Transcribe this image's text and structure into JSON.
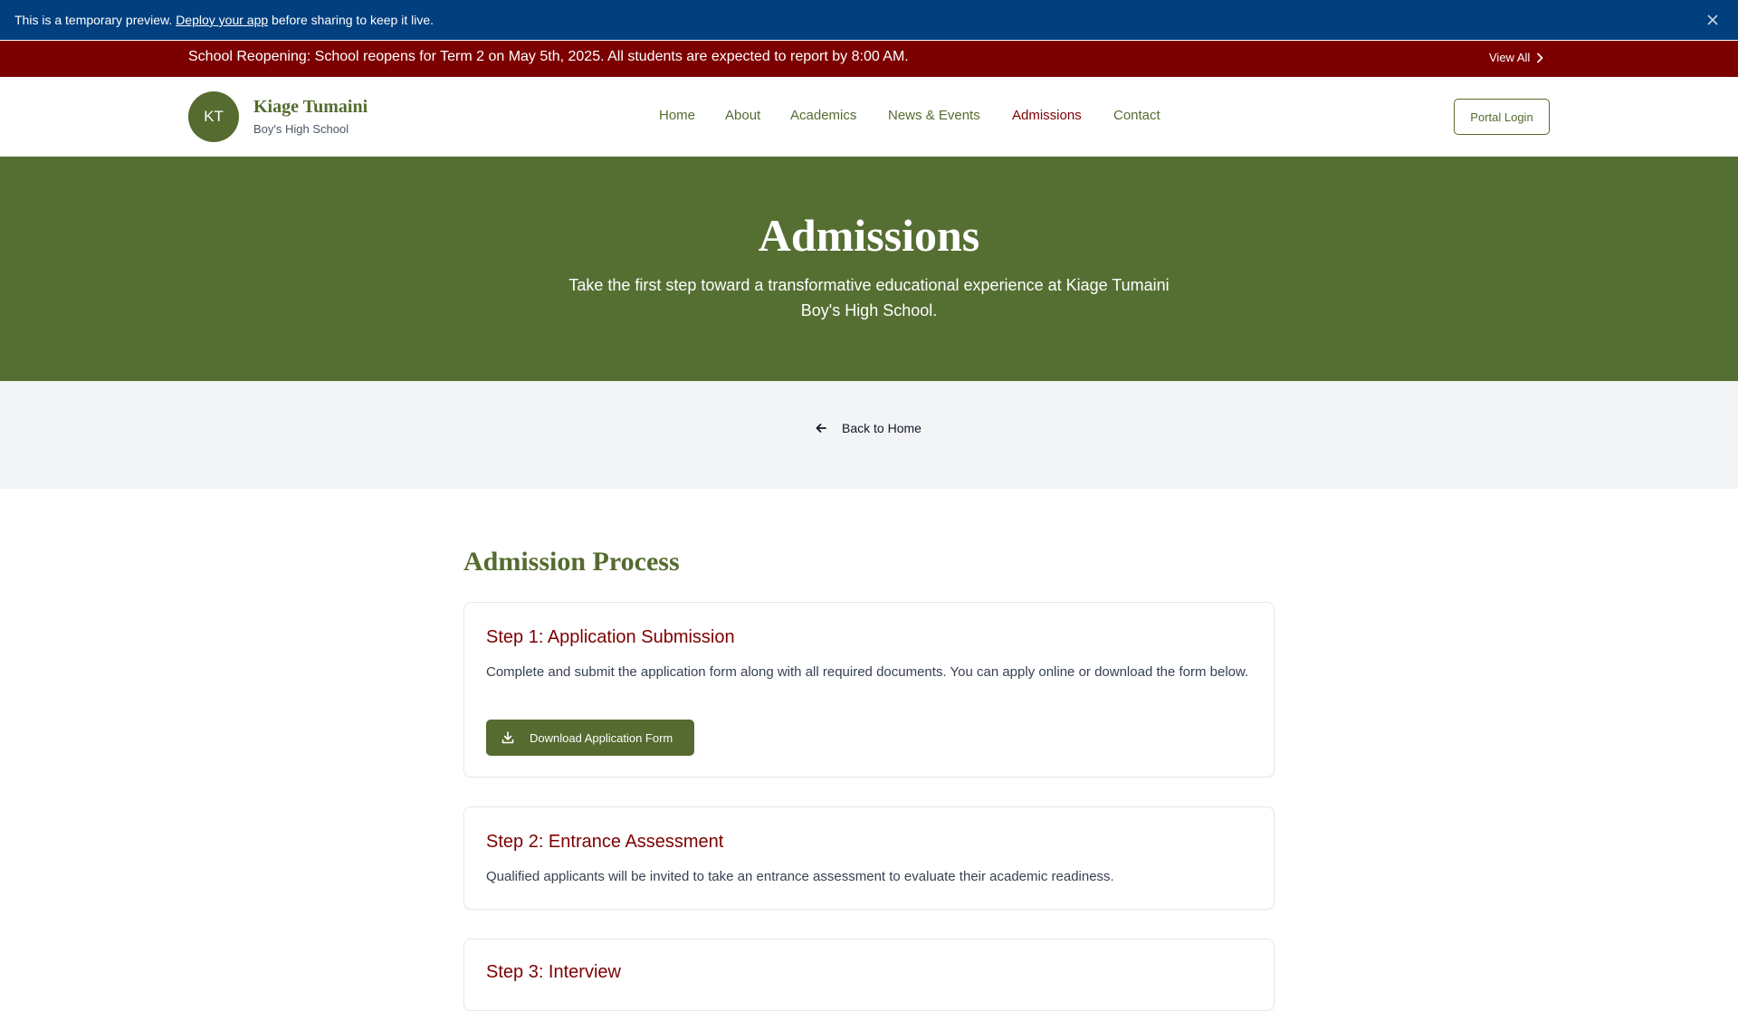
{
  "preview_bar": {
    "text_before": "This is a temporary preview.",
    "link_text": "Deploy your app",
    "text_after": "before sharing to keep it live."
  },
  "announcement": {
    "text": "School Reopening: School reopens for Term 2 on May 5th, 2025. All students are expected to report by 8:00 AM.",
    "view_all": "View All"
  },
  "header": {
    "logo_initials": "KT",
    "school_name": "Kiage Tumaini",
    "school_sub": "Boy's High School",
    "nav": [
      {
        "label": "Home",
        "active": false
      },
      {
        "label": "About",
        "active": false
      },
      {
        "label": "Academics",
        "active": false
      },
      {
        "label": "News & Events",
        "active": false
      },
      {
        "label": "Admissions",
        "active": true
      },
      {
        "label": "Contact",
        "active": false
      }
    ],
    "portal_login": "Portal Login"
  },
  "hero": {
    "title": "Admissions",
    "subtitle": "Take the first step toward a transformative educational experience at Kiage Tumaini Boy's High School."
  },
  "back_link": "Back to Home",
  "main": {
    "section_title": "Admission Process",
    "steps": [
      {
        "title": "Step 1: Application Submission",
        "text": "Complete and submit the application form along with all required documents. You can apply online or download the form below.",
        "button": "Download Application Form"
      },
      {
        "title": "Step 2: Entrance Assessment",
        "text": "Qualified applicants will be invited to take an entrance assessment to evaluate their academic readiness."
      },
      {
        "title": "Step 3: Interview"
      }
    ]
  },
  "colors": {
    "preview_blue": "#013f7e",
    "announce_red": "#7d0001",
    "brand_green": "#556b2f",
    "hero_green": "#556f33",
    "active_red": "#7d0001"
  },
  "icons": {
    "close": "close-icon",
    "view_all": "chevron-right-icon",
    "back": "arrow-left-icon",
    "download": "download-icon"
  }
}
